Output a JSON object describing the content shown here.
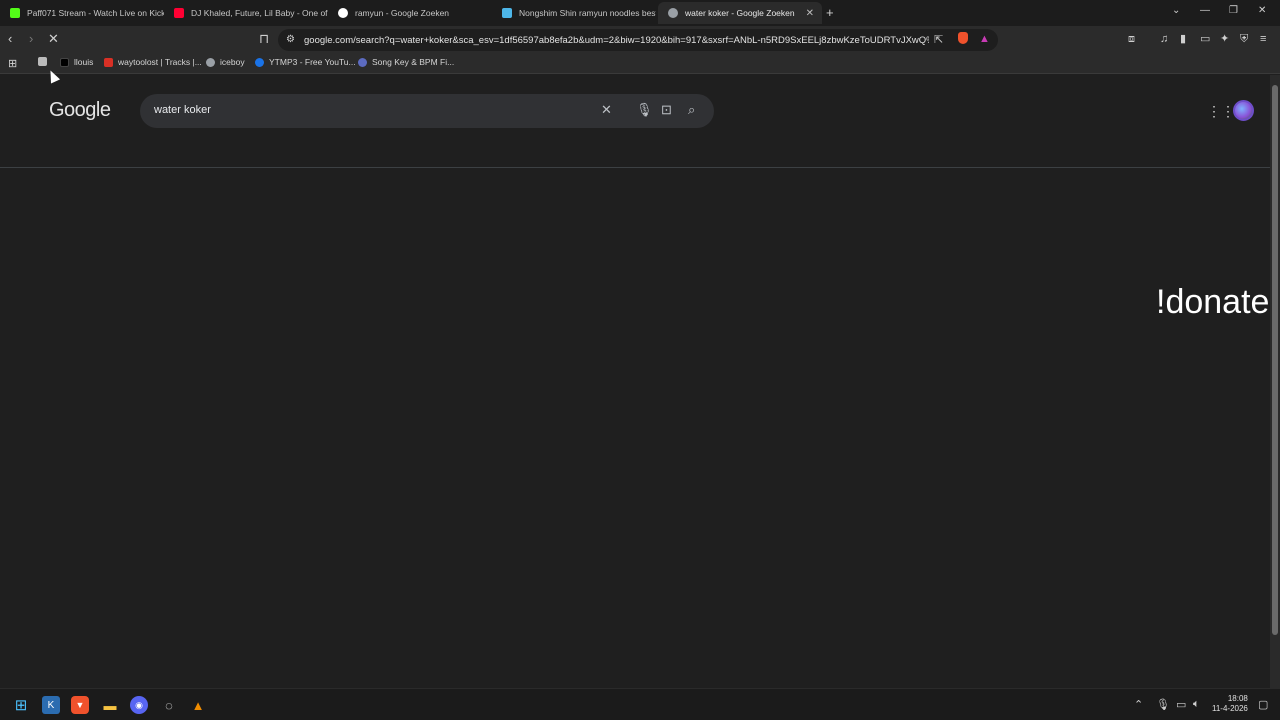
{
  "tabs": [
    {
      "title": "Paff071 Stream - Watch Live on Kick",
      "icon": "kick-icon",
      "color": "#53fc18"
    },
    {
      "title": "DJ Khaled, Future, Lil Baby - One of T",
      "icon": "youtube-icon",
      "color": "#ff0033"
    },
    {
      "title": "ramyun - Google Zoeken",
      "icon": "google-icon",
      "color": "#ffffff"
    },
    {
      "title": "Nongshim Shin ramyun noodles best",
      "icon": "site-icon",
      "color": "#4db6e8"
    },
    {
      "title": "water koker - Google Zoeken",
      "icon": "google-icon",
      "color": "#9aa0a6",
      "active": true
    }
  ],
  "toolbar": {
    "url": "google.com/search?q=water+koker&sca_esv=1df56597ab8efa2b&udm=2&biw=1920&bih=917&sxsrf=ANbL-n5RD9SxEELj8zbwKzeToUDRTvJXwQ%..."
  },
  "bookmarks": [
    {
      "label": "",
      "icon": "bookmark-app-icon",
      "color": "#bbbbbb"
    },
    {
      "label": "llouis",
      "icon": "black-square-icon",
      "color": "#000000"
    },
    {
      "label": "waytoolost | Tracks |...",
      "icon": "bandcamp-icon",
      "color": "#d93025"
    },
    {
      "label": "iceboy",
      "icon": "globe-icon",
      "color": "#9aa0a6"
    },
    {
      "label": "YTMP3 - Free YouTu...",
      "icon": "ytmp3-icon",
      "color": "#1a73e8"
    },
    {
      "label": "Song Key & BPM Fi...",
      "icon": "music-note-icon",
      "color": "#5c6bc0"
    }
  ],
  "search": {
    "logo": "Google",
    "query": "water koker"
  },
  "overlay_text": "!donate",
  "clock": {
    "time": "18:08",
    "date": "11-4-2026"
  }
}
